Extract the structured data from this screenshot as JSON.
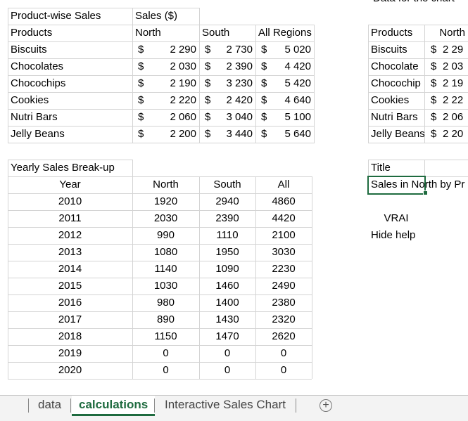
{
  "top_partial_text": "Data for the chart",
  "sales_table": {
    "title": "Product-wise Sales",
    "subtitle": "Sales ($)",
    "headers": [
      "Products",
      "North",
      "South",
      "All Regions"
    ],
    "currency": "$",
    "rows": [
      {
        "product": "Biscuits",
        "north": "2 290",
        "south": "2 730",
        "all": "5 020"
      },
      {
        "product": "Chocolates",
        "north": "2 030",
        "south": "2 390",
        "all": "4 420"
      },
      {
        "product": "Chocochips",
        "north": "2 190",
        "south": "3 230",
        "all": "5 420"
      },
      {
        "product": "Cookies",
        "north": "2 220",
        "south": "2 420",
        "all": "4 640"
      },
      {
        "product": "Nutri Bars",
        "north": "2 060",
        "south": "3 040",
        "all": "5 100"
      },
      {
        "product": "Jelly Beans",
        "north": "2 200",
        "south": "3 440",
        "all": "5 640"
      }
    ]
  },
  "chart_data_table": {
    "headers": [
      "Products",
      "North"
    ],
    "rows": [
      {
        "product": "Biscuits",
        "value": "2 29"
      },
      {
        "product": "Chocolate",
        "value": "2 03"
      },
      {
        "product": "Chocochip",
        "value": "2 19"
      },
      {
        "product": "Cookies",
        "value": "2 22"
      },
      {
        "product": "Nutri Bars",
        "value": "2 06"
      },
      {
        "product": "Jelly Beans",
        "value": "2 20"
      }
    ]
  },
  "yearly_table": {
    "title": "Yearly Sales Break-up",
    "headers": [
      "Year",
      "North",
      "South",
      "All"
    ],
    "rows": [
      {
        "year": "2010",
        "north": "1920",
        "south": "2940",
        "all": "4860"
      },
      {
        "year": "2011",
        "north": "2030",
        "south": "2390",
        "all": "4420"
      },
      {
        "year": "2012",
        "north": "990",
        "south": "1110",
        "all": "2100"
      },
      {
        "year": "2013",
        "north": "1080",
        "south": "1950",
        "all": "3030"
      },
      {
        "year": "2014",
        "north": "1140",
        "south": "1090",
        "all": "2230"
      },
      {
        "year": "2015",
        "north": "1030",
        "south": "1460",
        "all": "2490"
      },
      {
        "year": "2016",
        "north": "980",
        "south": "1400",
        "all": "2380"
      },
      {
        "year": "2017",
        "north": "890",
        "south": "1430",
        "all": "2320"
      },
      {
        "year": "2018",
        "north": "1150",
        "south": "1470",
        "all": "2620"
      },
      {
        "year": "2019",
        "north": "0",
        "south": "0",
        "all": "0"
      },
      {
        "year": "2020",
        "north": "0",
        "south": "0",
        "all": "0"
      }
    ]
  },
  "title_section": {
    "label": "Title",
    "value": "Sales in North by Pr",
    "vrai": "VRAI",
    "hide_help": "Hide help"
  },
  "tabs": [
    {
      "label": "data",
      "active": false
    },
    {
      "label": "calculations",
      "active": true
    },
    {
      "label": "Interactive Sales Chart",
      "active": false
    }
  ],
  "colors": {
    "accent": "#1e6b3f",
    "grid": "#d4d4d4",
    "tabbar": "#f3f3f3"
  }
}
